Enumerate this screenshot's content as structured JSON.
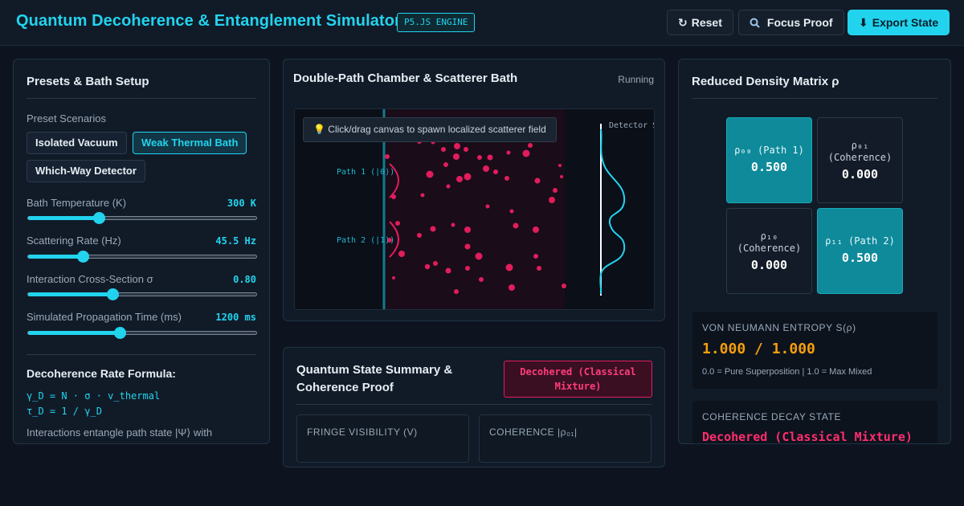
{
  "header": {
    "title": "Quantum Decoherence & Entanglement Simulator",
    "engine_badge": "P5.JS ENGINE",
    "buttons": {
      "reset": {
        "icon": "reset-icon",
        "label": "Reset"
      },
      "focus": {
        "icon": "magnifier-icon",
        "label": "Focus Proof"
      },
      "export": {
        "icon": "download-icon",
        "label": "Export State"
      }
    }
  },
  "presets": {
    "title": "Presets & Bath Setup",
    "scenarios_label": "Preset Scenarios",
    "scenarios": [
      "Isolated Vacuum",
      "Weak Thermal Bath",
      "Which-Way Detector"
    ],
    "active_scenario": "Weak Thermal Bath",
    "sliders": [
      {
        "label": "Bath Temperature (K)",
        "value": "300 K",
        "fraction": 0.31
      },
      {
        "label": "Scattering Rate (Hz)",
        "value": "45.5 Hz",
        "fraction": 0.24
      },
      {
        "label": "Interaction Cross-Section σ",
        "value": "0.80",
        "fraction": 0.37
      },
      {
        "label": "Simulated Propagation Time (ms)",
        "value": "1200 ms",
        "fraction": 0.4
      }
    ],
    "formula": {
      "title": "Decoherence Rate Formula:",
      "line1": "γ_D = N · σ · v_thermal",
      "line2": "τ_D = 1 / γ_D",
      "description": "Interactions entangle path state |Ψ⟩ with"
    }
  },
  "chamber": {
    "title": "Double-Path Chamber & Scatterer Bath",
    "status": "Running",
    "tooltip_icon": "lightbulb-icon",
    "tooltip": "Click/drag canvas to spawn localized scatterer field",
    "path1_label": "Path 1 (|0⟩)",
    "path2_label": "Path 2 (|1⟩)",
    "detector_label": "Detector S"
  },
  "summary": {
    "title": "Quantum State Summary & Coherence Proof",
    "badge": "Decohered (Classical Mixture)",
    "cards": [
      {
        "label": "FRINGE VISIBILITY (V)"
      },
      {
        "label": "COHERENCE |ρ₀₁|"
      }
    ]
  },
  "matrix": {
    "title": "Reduced Density Matrix ρ",
    "cells": [
      {
        "label": "ρ₀₀ (Path 1)",
        "value": "0.500"
      },
      {
        "label": "ρ₀₁ (Coherence)",
        "value": "0.000"
      },
      {
        "label": "ρ₁₀ (Coherence)",
        "value": "0.000"
      },
      {
        "label": "ρ₁₁ (Path 2)",
        "value": "0.500"
      }
    ],
    "entropy": {
      "title": "VON NEUMANN ENTROPY S(ρ)",
      "value": "1.000 / 1.000",
      "note": "0.0 = Pure Superposition | 1.0 = Max Mixed"
    },
    "decay": {
      "title": "COHERENCE DECAY STATE",
      "value": "Decohered (Classical Mixture)"
    }
  },
  "colors": {
    "accent": "#22d3ee",
    "scatterer": "#e11d5c",
    "entropy": "#f59e0b",
    "decohered": "#ff2d6e"
  }
}
